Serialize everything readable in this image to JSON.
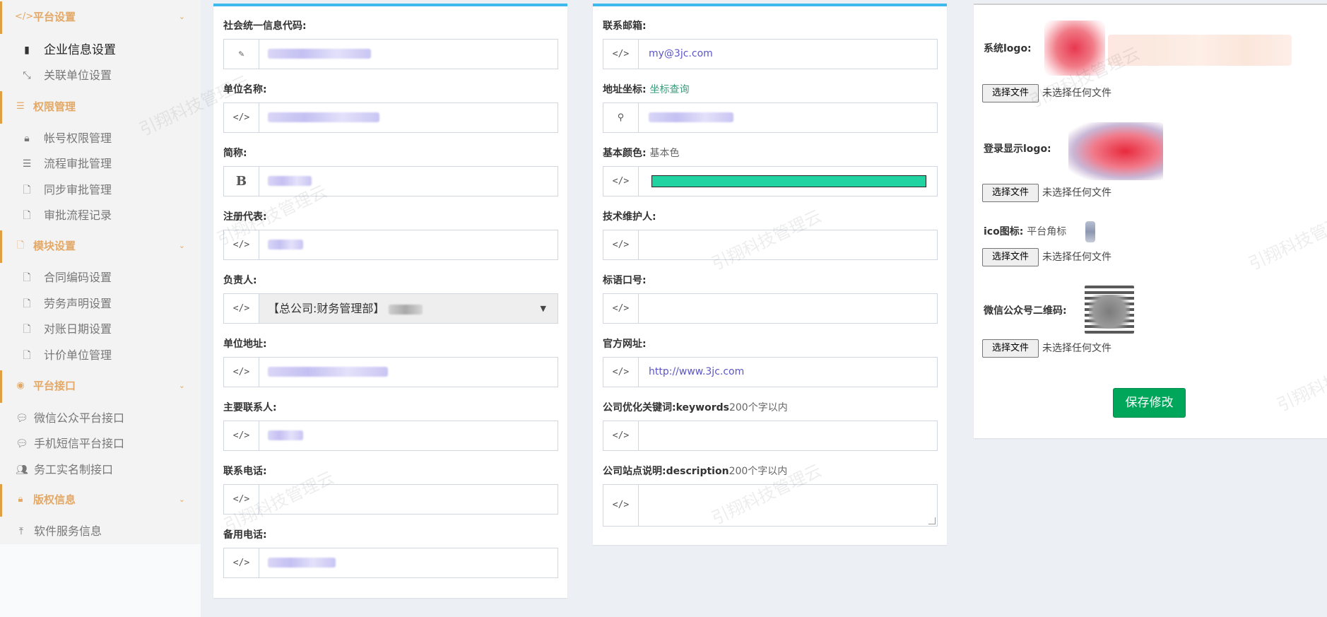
{
  "sidebar": {
    "sections": [
      {
        "label": "平台设置",
        "icon": "code-icon"
      },
      {
        "label": "权限管理",
        "icon": "list-icon"
      },
      {
        "label": "模块设置",
        "icon": "file-icon"
      },
      {
        "label": "平台接口",
        "icon": "weibo-icon"
      },
      {
        "label": "版权信息",
        "icon": "lock-icon"
      }
    ],
    "items": [
      {
        "label": "企业信息设置",
        "icon": "building-icon"
      },
      {
        "label": "关联单位设置",
        "icon": "compress-icon"
      },
      {
        "label": "帐号权限管理",
        "icon": "lock-icon"
      },
      {
        "label": "流程审批管理",
        "icon": "list-icon"
      },
      {
        "label": "同步审批管理",
        "icon": "file-icon"
      },
      {
        "label": "审批流程记录",
        "icon": "file-icon"
      },
      {
        "label": "合同编码设置",
        "icon": "file-icon"
      },
      {
        "label": "劳务声明设置",
        "icon": "file-icon"
      },
      {
        "label": "对账日期设置",
        "icon": "file-icon"
      },
      {
        "label": "计价单位管理",
        "icon": "file-icon"
      },
      {
        "label": "微信公众平台接口",
        "icon": "wechat-icon"
      },
      {
        "label": "手机短信平台接口",
        "icon": "wechat-icon"
      },
      {
        "label": "务工实名制接口",
        "icon": "users-icon"
      },
      {
        "label": "软件服务信息",
        "icon": "upload-icon"
      }
    ]
  },
  "form_left": {
    "credit_code": {
      "label": "社会统一信息代码:"
    },
    "unit_name": {
      "label": "单位名称:"
    },
    "short_name": {
      "label": "简称:"
    },
    "legal_rep": {
      "label": "注册代表:"
    },
    "manager": {
      "label": "负责人:",
      "value": "【总公司:财务管理部】"
    },
    "address": {
      "label": "单位地址:"
    },
    "contact": {
      "label": "主要联系人:"
    },
    "phone": {
      "label": "联系电话:"
    },
    "backup_phone": {
      "label": "备用电话:"
    }
  },
  "form_middle": {
    "email": {
      "label": "联系邮箱:",
      "value": "my@3jc.com"
    },
    "coords": {
      "label": "地址坐标:",
      "link": "坐标查询"
    },
    "color": {
      "label": "基本颜色:",
      "sub": "基本色",
      "value": "#20d3a0"
    },
    "maintainer": {
      "label": "技术维护人:"
    },
    "slogan": {
      "label": "标语口号:"
    },
    "website": {
      "label": "官方网址:",
      "value": "http://www.3jc.com"
    },
    "keywords": {
      "label": "公司优化关键词:",
      "bold": "keywords",
      "sub": "200个字以内"
    },
    "description": {
      "label": "公司站点说明:",
      "bold": "description",
      "sub": "200个字以内"
    }
  },
  "form_right": {
    "system_logo": {
      "label": "系统logo:"
    },
    "login_logo": {
      "label": "登录显示logo:"
    },
    "ico": {
      "label": "ico图标:",
      "sub": "平台角标"
    },
    "wechat_qr": {
      "label": "微信公众号二维码:"
    },
    "file_button": "选择文件",
    "no_file": "未选择任何文件",
    "save_button": "保存修改"
  },
  "watermark": "引翔科技管理云"
}
